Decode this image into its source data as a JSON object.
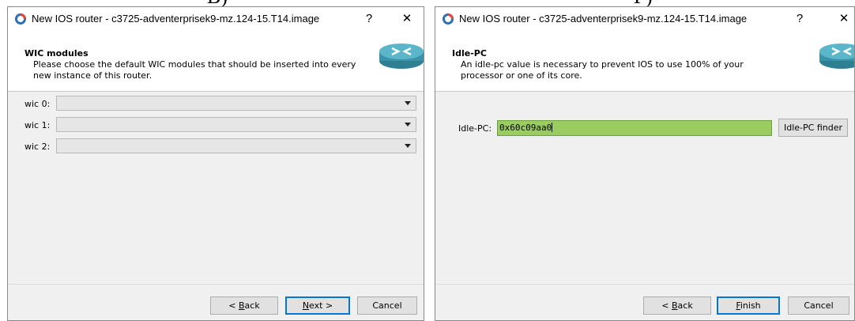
{
  "captions": [
    "B)",
    "Г)"
  ],
  "window": {
    "title": "New IOS router - c3725-adventerprisek9-mz.124-15.T14.image",
    "help_glyph": "?",
    "close_glyph": "✕",
    "app_icon": "gns3-icon"
  },
  "wic": {
    "header_title": "WIC modules",
    "header_subtitle": "Please choose the default WIC modules that should be inserted into every new instance of this router.",
    "slots": [
      {
        "label": "wic 0:",
        "value": ""
      },
      {
        "label": "wic 1:",
        "value": ""
      },
      {
        "label": "wic 2:",
        "value": ""
      }
    ],
    "buttons": {
      "back": "< Back",
      "back_hotkey": "B",
      "next": "Next >",
      "next_hotkey": "N",
      "cancel": "Cancel"
    }
  },
  "idle": {
    "header_title": "Idle-PC",
    "header_subtitle": "An idle-pc value is necessary to prevent IOS to use 100% of your processor or one of its core.",
    "field_label": "Idle-PC:",
    "field_value": "0x60c09aa0",
    "finder_button": "Idle-PC finder",
    "buttons": {
      "back": "< Back",
      "back_hotkey": "B",
      "finish": "Finish",
      "finish_hotkey": "F",
      "cancel": "Cancel"
    }
  },
  "colors": {
    "idle_field_bg": "#9bcc62",
    "default_button_border": "#0078d7"
  }
}
